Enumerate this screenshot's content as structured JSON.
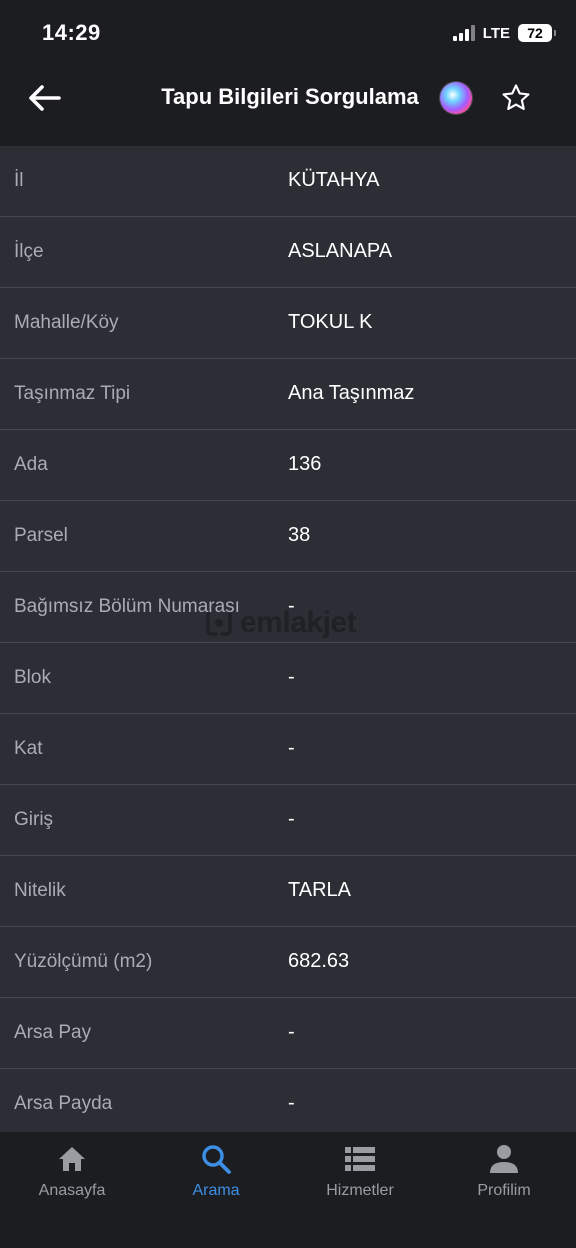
{
  "status_bar": {
    "time": "14:29",
    "network": "LTE",
    "battery": "72"
  },
  "nav": {
    "title": "Tapu Bilgileri Sorgulama"
  },
  "rows": [
    {
      "label": "İl",
      "value": "KÜTAHYA"
    },
    {
      "label": "İlçe",
      "value": "ASLANAPA"
    },
    {
      "label": "Mahalle/Köy",
      "value": "TOKUL K"
    },
    {
      "label": "Taşınmaz Tipi",
      "value": "Ana Taşınmaz"
    },
    {
      "label": "Ada",
      "value": "136"
    },
    {
      "label": "Parsel",
      "value": "38"
    },
    {
      "label": "Bağımsız Bölüm Numarası",
      "value": "-"
    },
    {
      "label": "Blok",
      "value": "-"
    },
    {
      "label": "Kat",
      "value": "-"
    },
    {
      "label": "Giriş",
      "value": "-"
    },
    {
      "label": "Nitelik",
      "value": "TARLA"
    },
    {
      "label": "Yüzölçümü (m2)",
      "value": "682.63"
    },
    {
      "label": "Arsa Pay",
      "value": "-"
    },
    {
      "label": "Arsa Payda",
      "value": "-"
    }
  ],
  "watermark": {
    "text": "emlakjet"
  },
  "tabs": [
    {
      "label": "Anasayfa",
      "icon": "home-icon",
      "active": false
    },
    {
      "label": "Arama",
      "icon": "search-icon",
      "active": true
    },
    {
      "label": "Hizmetler",
      "icon": "list-icon",
      "active": false
    },
    {
      "label": "Profilim",
      "icon": "person-icon",
      "active": false
    }
  ],
  "colors": {
    "background": "#1c1d20",
    "row_background": "#2b2e34",
    "label": "#a9acb3",
    "accent": "#3d8fe5"
  }
}
